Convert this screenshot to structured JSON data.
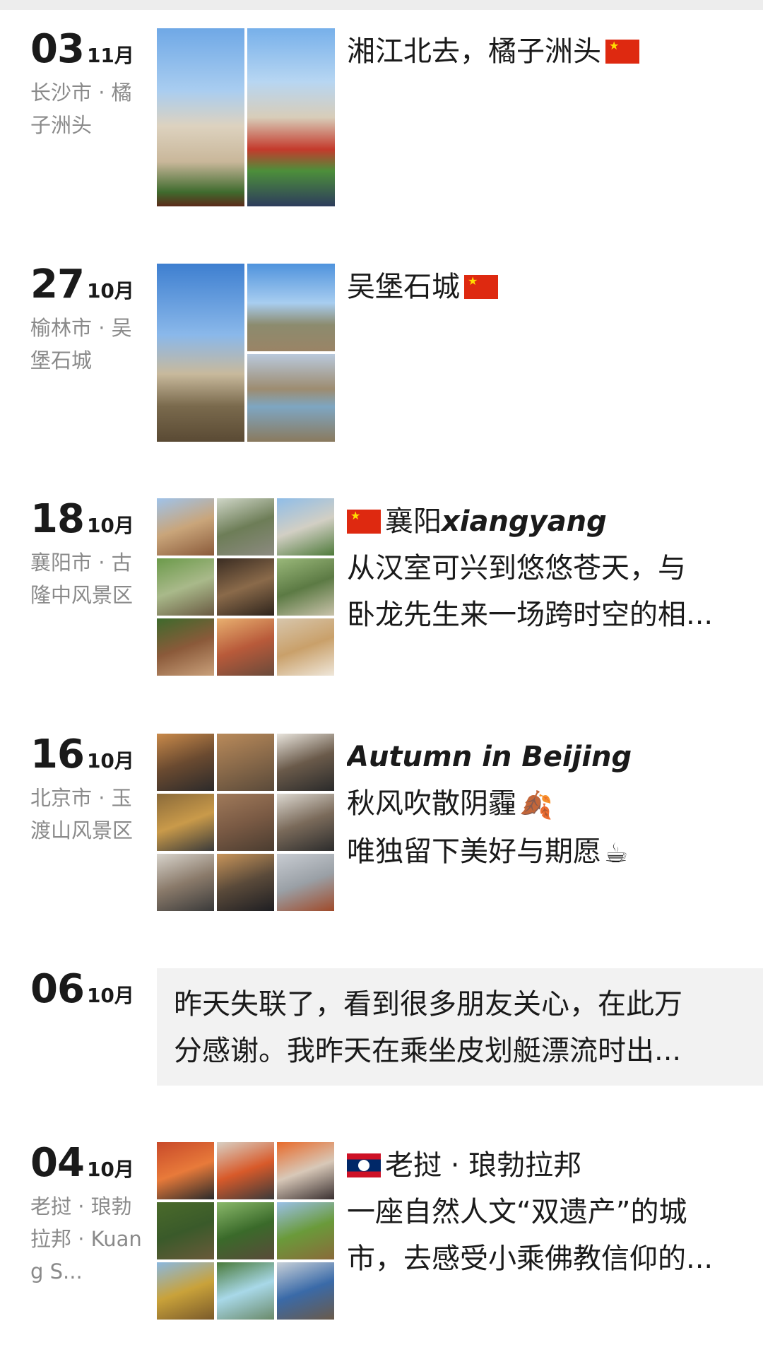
{
  "entries": [
    {
      "day": "03",
      "month": "11月",
      "location": "长沙市 · 橘子洲头",
      "lines": [
        "湘江北去，橘子洲头"
      ],
      "flag": "china-flag",
      "photo_count": 2
    },
    {
      "day": "27",
      "month": "10月",
      "location": "榆林市 · 吴堡石城",
      "lines": [
        "吴堡石城"
      ],
      "flag": "china-flag",
      "photo_count": 3
    },
    {
      "day": "18",
      "month": "10月",
      "location": "襄阳市 · 古隆中风景区",
      "title_cn": "襄阳",
      "title_en": "xiangyang",
      "lines": [
        "从汉室可兴到悠悠苍天，与",
        "卧龙先生来一场跨时空的相..."
      ],
      "flag": "china-flag",
      "photo_count": 9
    },
    {
      "day": "16",
      "month": "10月",
      "location": "北京市 · 玉渡山风景区",
      "title_en": "Autumn in Beijing",
      "lines": [
        "秋风吹散阴霾",
        "唯独留下美好与期愿"
      ],
      "emojis": [
        "🍂",
        "☕"
      ],
      "photo_count": 9
    },
    {
      "day": "06",
      "month": "10月",
      "lines": [
        "昨天失联了，看到很多朋友关心，在此万",
        "分感谢。我昨天在乘坐皮划艇漂流时出..."
      ]
    },
    {
      "day": "04",
      "month": "10月",
      "location": "老挝 · 琅勃拉邦 · Kuang S...",
      "title_cn": "老挝 · 琅勃拉邦",
      "lines": [
        "一座自然人文“双遗产”的城",
        "市，去感受小乘佛教信仰的..."
      ],
      "flag": "laos-flag",
      "photo_count": 9
    }
  ],
  "colors": {
    "background": "#ffffff",
    "top_strip": "#ededed",
    "location_text": "#8a8a8a",
    "text_box": "#f2f2f2"
  }
}
